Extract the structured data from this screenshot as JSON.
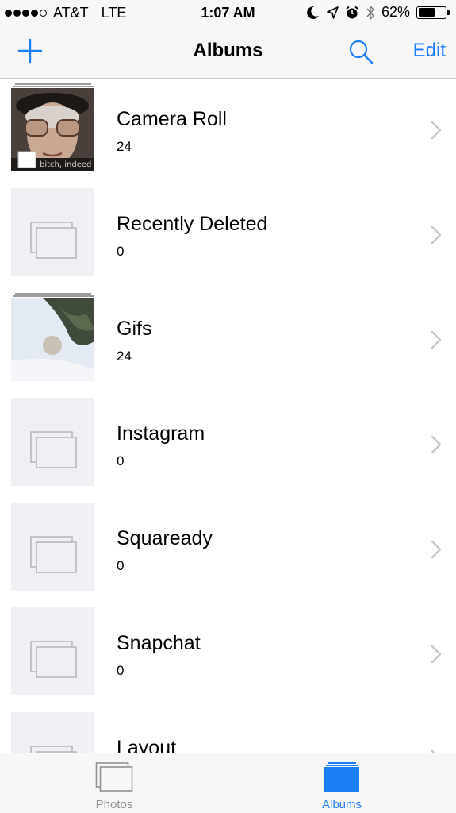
{
  "status_bar": {
    "carrier": "AT&T",
    "network": "LTE",
    "time": "1:07 AM",
    "battery_percent": "62%",
    "battery_level": 0.62,
    "signal_bars": 4,
    "icons": [
      "moon-icon",
      "location-arrow-icon",
      "alarm-icon",
      "bluetooth-icon",
      "battery-icon"
    ]
  },
  "nav": {
    "title": "Albums",
    "add_icon": "plus-icon",
    "search_icon": "search-icon",
    "edit_label": "Edit"
  },
  "albums": [
    {
      "name": "Camera Roll",
      "count": "24",
      "thumb": "photo",
      "photo_caption": "bitch, indeed"
    },
    {
      "name": "Recently Deleted",
      "count": "0",
      "thumb": "empty"
    },
    {
      "name": "Gifs",
      "count": "24",
      "thumb": "photo"
    },
    {
      "name": "Instagram",
      "count": "0",
      "thumb": "empty"
    },
    {
      "name": "Squaready",
      "count": "0",
      "thumb": "empty"
    },
    {
      "name": "Snapchat",
      "count": "0",
      "thumb": "empty"
    },
    {
      "name": "Layout",
      "count": "",
      "thumb": "empty"
    }
  ],
  "tabs": [
    {
      "label": "Photos",
      "icon": "photos-stack-icon",
      "active": false
    },
    {
      "label": "Albums",
      "icon": "albums-stack-icon",
      "active": true
    }
  ],
  "colors": {
    "accent": "#1a7ef7",
    "bar_background": "#f7f7f7",
    "placeholder": "#efeff4",
    "chevron": "#c7c7cc",
    "inactive_tab": "#929292"
  }
}
